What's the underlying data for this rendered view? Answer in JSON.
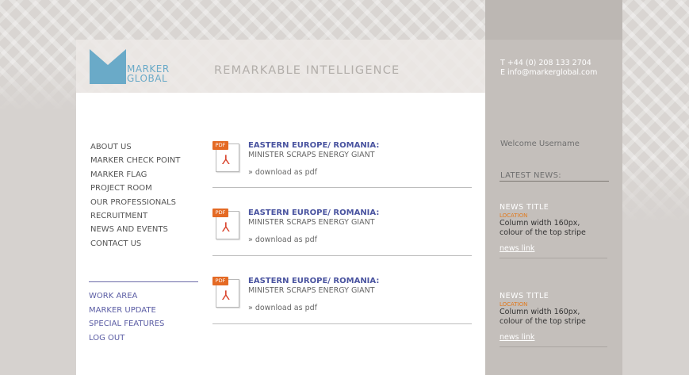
{
  "brand": {
    "logo_line1": "MARKER",
    "logo_line2": "GLOBAL",
    "tagline": "REMARKABLE INTELLIGENCE",
    "logo_color": "#6aaac8"
  },
  "contact": {
    "phone": "T  +44 (0) 208 133 2704",
    "email": "E  info@markerglobal.com"
  },
  "nav": {
    "items": [
      "ABOUT US",
      "MARKER CHECK POINT",
      "MARKER FLAG",
      "PROJECT ROOM",
      "OUR PROFESSIONALS",
      "RECRUITMENT",
      "NEWS AND EVENTS",
      "CONTACT US"
    ]
  },
  "work_area": {
    "items": [
      "WORK AREA",
      "MARKER UPDATE",
      "SPECIAL FEATURES",
      "LOG OUT"
    ]
  },
  "articles": [
    {
      "badge": "PDF",
      "title": "EASTERN EUROPE/ ROMANIA:",
      "subtitle": "MINISTER SCRAPS ENERGY GIANT",
      "link": "» download as pdf"
    },
    {
      "badge": "PDF",
      "title": "EASTERN EUROPE/ ROMANIA:",
      "subtitle": "MINISTER SCRAPS ENERGY GIANT",
      "link": "» download as pdf"
    },
    {
      "badge": "PDF",
      "title": "EASTERN EUROPE/ ROMANIA:",
      "subtitle": "MINISTER SCRAPS ENERGY GIANT",
      "link": "» download as pdf"
    }
  ],
  "sidebar": {
    "welcome": "Welcome Username",
    "latest_news_label": "LATEST NEWS:",
    "news": [
      {
        "title": "NEWS TITLE",
        "location": "LOCATION",
        "body_line1": "Column width 160px,",
        "body_line2": "colour of the top stripe",
        "link": "news link"
      },
      {
        "title": "NEWS TITLE",
        "location": "LOCATION",
        "body_line1": "Column width 160px,",
        "body_line2": "colour of the top stripe",
        "link": "news link"
      }
    ]
  },
  "colors": {
    "accent_blue": "#4a54a0",
    "work_area_purple": "#5b5da4",
    "location_orange": "#e07a1f",
    "pdf_orange": "#e46a24"
  }
}
